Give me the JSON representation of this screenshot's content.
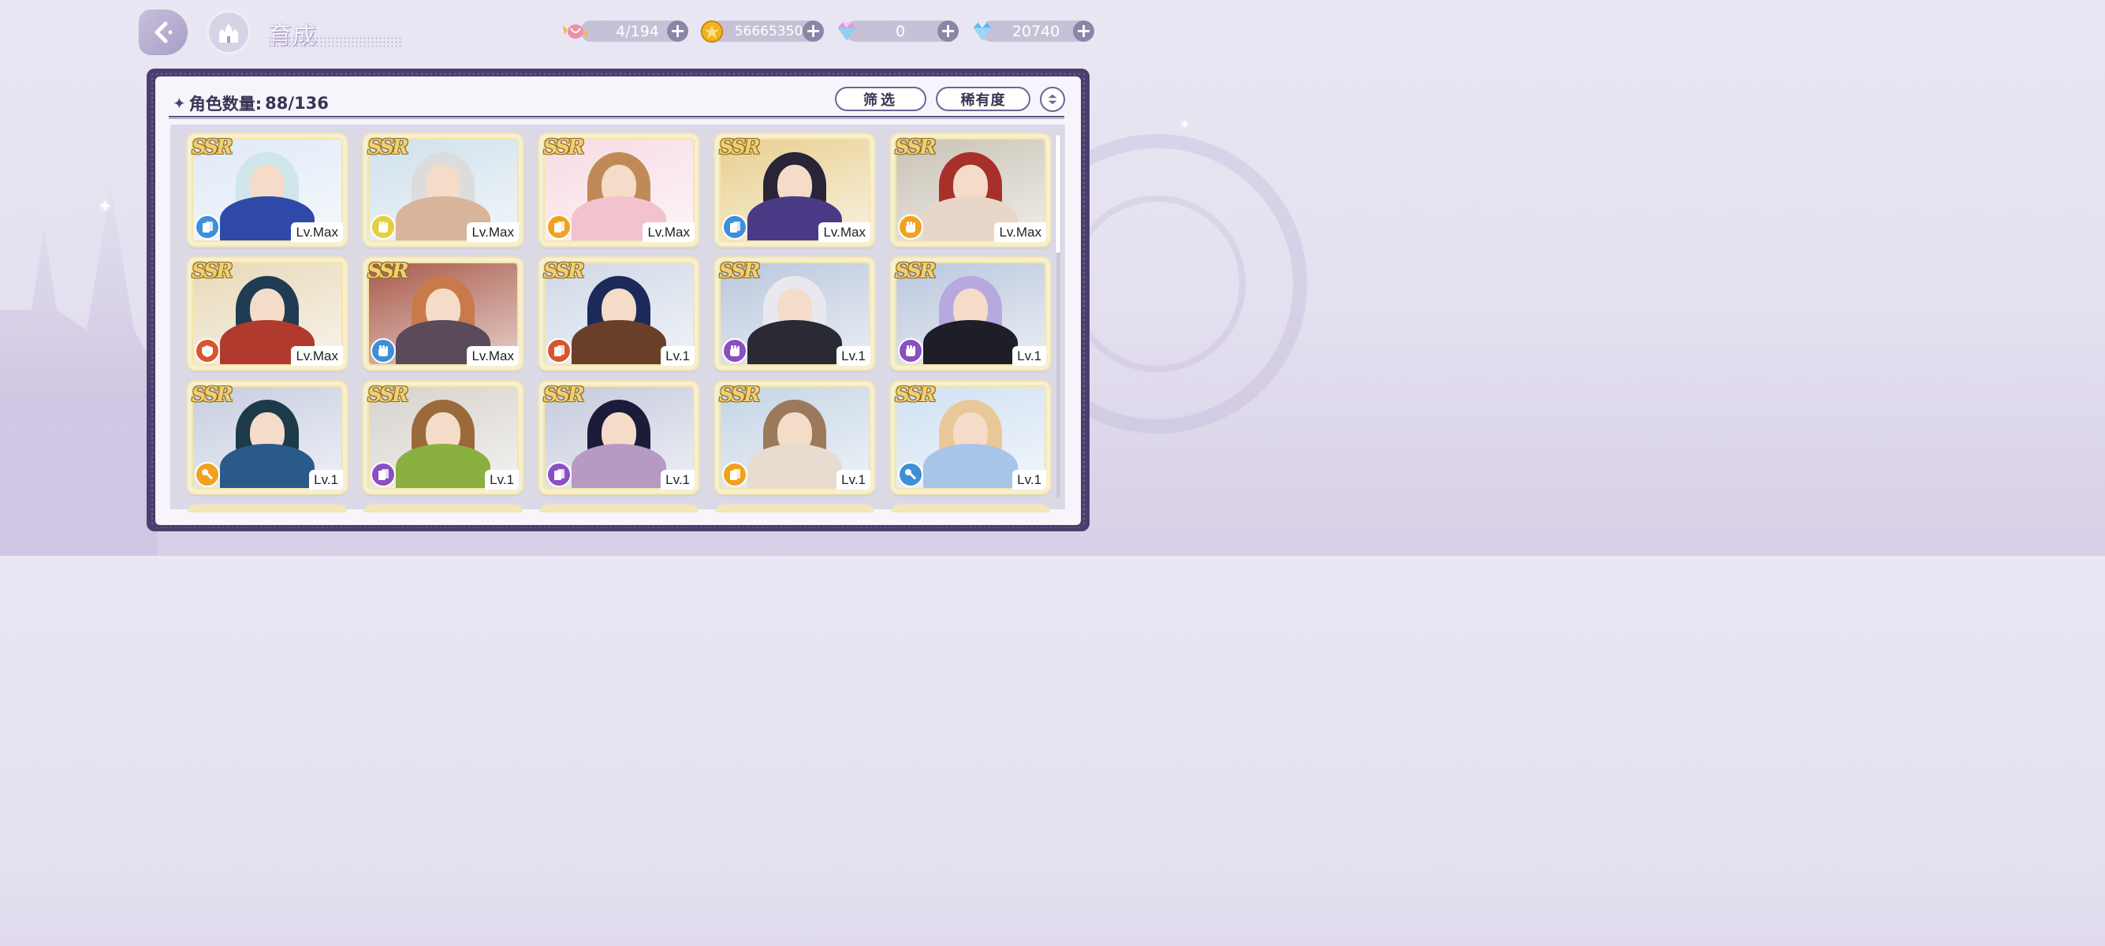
{
  "header": {
    "title": "育成",
    "resources": [
      {
        "name": "stamina",
        "icon": "candy-icon",
        "value": "4/194"
      },
      {
        "name": "gold",
        "icon": "gold-coin-icon",
        "value": "56665350"
      },
      {
        "name": "rainbow-gem",
        "icon": "rainbow-diamond-icon",
        "value": "0"
      },
      {
        "name": "blue-gem",
        "icon": "blue-diamond-icon",
        "value": "20740"
      }
    ]
  },
  "panel": {
    "count_label": "角色数量:",
    "count_value": "88/136",
    "filter_label": "筛选",
    "rarity_label": "稀有度"
  },
  "cards": [
    {
      "rarity": "SSR",
      "level": "Lv.Max",
      "type_color": "#3f8fd8",
      "type_icon": "card-icon",
      "bg": "#dfe9f6",
      "hair": "#cfe6ea",
      "outfit": "#2f49a8"
    },
    {
      "rarity": "SSR",
      "level": "Lv.Max",
      "type_color": "#e4cf3f",
      "type_icon": "fist-icon",
      "bg": "#cfe0ec",
      "hair": "#dcdcdc",
      "outfit": "#d8b49a"
    },
    {
      "rarity": "SSR",
      "level": "Lv.Max",
      "type_color": "#f0a21f",
      "type_icon": "card-icon",
      "bg": "#f7dbe3",
      "hair": "#c08a58",
      "outfit": "#f2c2cf"
    },
    {
      "rarity": "SSR",
      "level": "Lv.Max",
      "type_color": "#3f8fd8",
      "type_icon": "card-icon",
      "bg": "#e8cf8f",
      "hair": "#2a2438",
      "outfit": "#4a3a86"
    },
    {
      "rarity": "SSR",
      "level": "Lv.Max",
      "type_color": "#f0a21f",
      "type_icon": "fist-icon",
      "bg": "#c9c2b4",
      "hair": "#a8302a",
      "outfit": "#e8d6c8"
    },
    {
      "rarity": "SSR",
      "level": "Lv.Max",
      "type_color": "#d9552d",
      "type_icon": "shield-icon",
      "bg": "#e7d9b8",
      "hair": "#1f3c52",
      "outfit": "#b03a2e"
    },
    {
      "rarity": "SSR",
      "level": "Lv.Max",
      "type_color": "#3f8fd8",
      "type_icon": "fist-icon",
      "bg": "#a85a4a",
      "hair": "#c97a4a",
      "outfit": "#5a4a5a"
    },
    {
      "rarity": "SSR",
      "level": "Lv.1",
      "type_color": "#d9552d",
      "type_icon": "card-icon",
      "bg": "#cfd8e6",
      "hair": "#1c2a5a",
      "outfit": "#6a3f2a"
    },
    {
      "rarity": "SSR",
      "level": "Lv.1",
      "type_color": "#8a4fc0",
      "type_icon": "fist-icon",
      "bg": "#b9c6dc",
      "hair": "#e8e8ee",
      "outfit": "#2a2a34"
    },
    {
      "rarity": "SSR",
      "level": "Lv.1",
      "type_color": "#8a4fc0",
      "type_icon": "fist-icon",
      "bg": "#b9c6dc",
      "hair": "#b7a8e0",
      "outfit": "#1e1e28"
    },
    {
      "rarity": "SSR",
      "level": "Lv.1",
      "type_color": "#f0a21f",
      "type_icon": "key-icon",
      "bg": "#c6cde0",
      "hair": "#1d3a48",
      "outfit": "#2a5a8a"
    },
    {
      "rarity": "SSR",
      "level": "Lv.1",
      "type_color": "#8a4fc0",
      "type_icon": "card-icon",
      "bg": "#d6d2cc",
      "hair": "#9a6a3a",
      "outfit": "#8ab040"
    },
    {
      "rarity": "SSR",
      "level": "Lv.1",
      "type_color": "#8a4fc0",
      "type_icon": "card-icon",
      "bg": "#c5c9dc",
      "hair": "#1c1c3a",
      "outfit": "#b79ac4"
    },
    {
      "rarity": "SSR",
      "level": "Lv.1",
      "type_color": "#f0a21f",
      "type_icon": "card-icon",
      "bg": "#c4d4e4",
      "hair": "#9a7a5a",
      "outfit": "#e8dcd0"
    },
    {
      "rarity": "SSR",
      "level": "Lv.1",
      "type_color": "#3f8fd8",
      "type_icon": "key-icon",
      "bg": "#cfe0f2",
      "hair": "#e8c898",
      "outfit": "#a8c4e8"
    }
  ]
}
